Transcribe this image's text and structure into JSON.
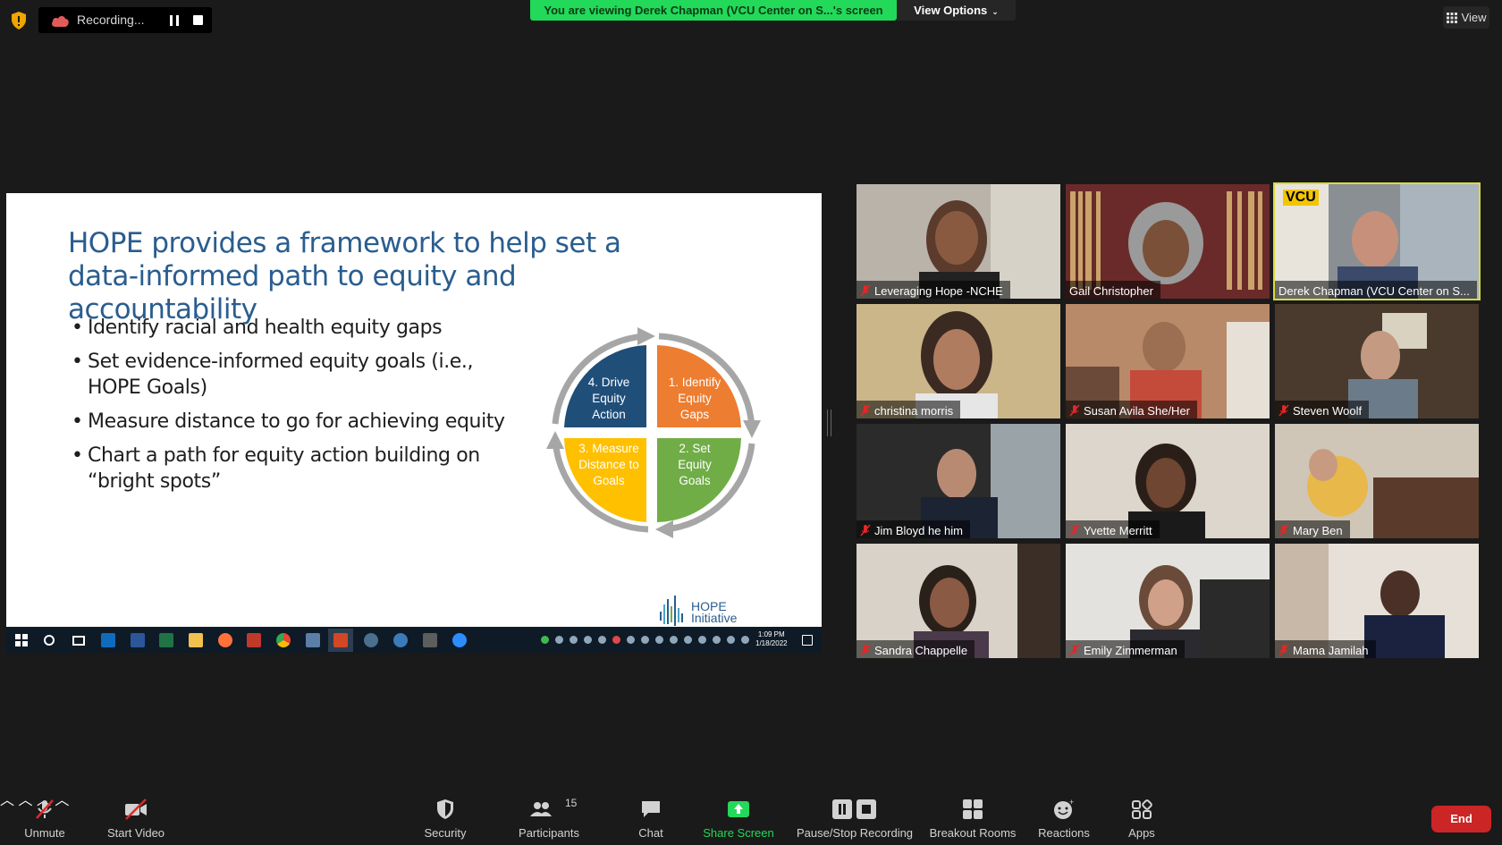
{
  "top_bar": {
    "recording_label": "Recording...",
    "banner_text": "You are viewing Derek Chapman (VCU Center on S...'s screen",
    "view_options_label": "View Options",
    "view_label": "View"
  },
  "slide": {
    "title": "HOPE provides a framework to help set a data-informed path to equity and accountability",
    "bullets": [
      "Identify racial and health equity gaps",
      "Set evidence-informed equity goals (i.e., HOPE Goals)",
      "Measure distance to go for achieving equity",
      "Chart a path for equity action building on “bright spots”"
    ],
    "cycle": [
      {
        "label_lines": [
          "4. Drive",
          "Equity",
          "Action"
        ],
        "color": "#1f4e79"
      },
      {
        "label_lines": [
          "1. Identify",
          "Equity",
          "Gaps"
        ],
        "color": "#ed7d31"
      },
      {
        "label_lines": [
          "2. Set",
          "Equity",
          "Goals"
        ],
        "color": "#70ad47"
      },
      {
        "label_lines": [
          "3. Measure",
          "Distance to",
          "Goals"
        ],
        "color": "#ffc000"
      }
    ],
    "logo_line1": "HOPE",
    "logo_line2": "Initiative"
  },
  "embedded_taskbar": {
    "time": "1:09 PM",
    "date": "1/18/2022"
  },
  "participants": [
    {
      "name": "Leveraging Hope -NCHE",
      "muted": true
    },
    {
      "name": "Gail Christopher",
      "muted": false
    },
    {
      "name": "Derek Chapman (VCU Center on S...",
      "muted": false,
      "active": true,
      "logo": "VCU"
    },
    {
      "name": "christina morris",
      "muted": true
    },
    {
      "name": "Susan Avila She/Her",
      "muted": true
    },
    {
      "name": "Steven Woolf",
      "muted": true
    },
    {
      "name": "Jim Bloyd he him",
      "muted": true
    },
    {
      "name": "Yvette Merritt",
      "muted": true
    },
    {
      "name": "Mary Ben",
      "muted": true
    },
    {
      "name": "Sandra Chappelle",
      "muted": true
    },
    {
      "name": "Emily Zimmerman",
      "muted": true
    },
    {
      "name": "Mama Jamilah",
      "muted": true
    }
  ],
  "toolbar": {
    "unmute": "Unmute",
    "start_video": "Start Video",
    "security": "Security",
    "participants": "Participants",
    "participants_count": "15",
    "chat": "Chat",
    "share_screen": "Share Screen",
    "pause_stop_recording": "Pause/Stop Recording",
    "breakout_rooms": "Breakout Rooms",
    "reactions": "Reactions",
    "apps": "Apps",
    "end": "End"
  },
  "colors": {
    "banner_green": "#23d959",
    "active_speaker": "#d7db3d",
    "end_red": "#cc2525",
    "slide_title_blue": "#2a5d8f"
  }
}
